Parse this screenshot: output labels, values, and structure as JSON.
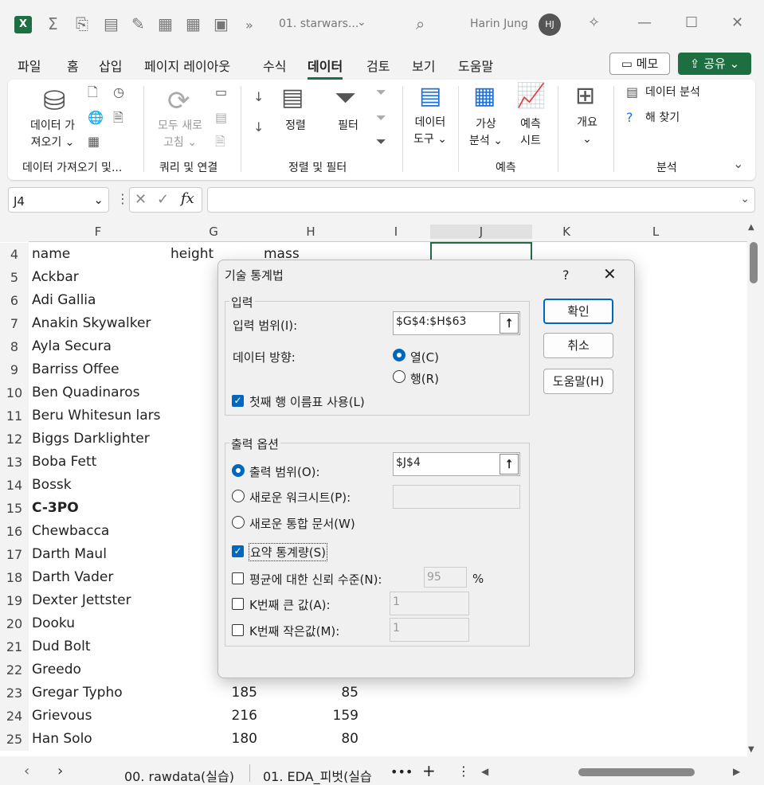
{
  "titlebar": {
    "file_title": "01. starwars...",
    "user_name": "Harin Jung",
    "user_initials": "HJ"
  },
  "ribbon_tabs": [
    "파일",
    "홈",
    "삽입",
    "페이지 레이아웃",
    "수식",
    "데이터",
    "검토",
    "보기",
    "도움말"
  ],
  "active_tab": "데이터",
  "memo_label": "메모",
  "share_label": "공유",
  "ribbon": {
    "get_data_1": "데이터 가",
    "get_data_2": "져오기",
    "refresh_1": "모두 새로",
    "refresh_2": "고침",
    "sort_label": "정렬",
    "filter_label": "필터",
    "data_tools_1": "데이터",
    "data_tools_2": "도구",
    "whatif_1": "가상",
    "whatif_2": "분석",
    "forecast_1": "예측",
    "forecast_2": "시트",
    "outline": "개요",
    "data_analysis": "데이터 분석",
    "solver": "해 찾기",
    "group_get": "데이터 가져오기 및...",
    "group_query": "쿼리 및 연결",
    "group_sort": "정렬 및 필터",
    "group_forecast": "예측",
    "group_analysis": "분석"
  },
  "formula_bar": {
    "name_box": "J4",
    "fx": "fx",
    "formula": ""
  },
  "columns": [
    "F",
    "G",
    "H",
    "I",
    "J",
    "K",
    "L"
  ],
  "rows": [
    {
      "n": "4",
      "name": "name",
      "height": "height",
      "mass": "mass"
    },
    {
      "n": "5",
      "name": "Ackbar",
      "height": "",
      "mass": ""
    },
    {
      "n": "6",
      "name": "Adi Gallia",
      "height": "",
      "mass": ""
    },
    {
      "n": "7",
      "name": "Anakin Skywalker",
      "height": "",
      "mass": ""
    },
    {
      "n": "8",
      "name": "Ayla Secura",
      "height": "",
      "mass": ""
    },
    {
      "n": "9",
      "name": "Barriss Offee",
      "height": "",
      "mass": ""
    },
    {
      "n": "10",
      "name": "Ben Quadinaros",
      "height": "",
      "mass": ""
    },
    {
      "n": "11",
      "name": "Beru Whitesun lars",
      "height": "",
      "mass": ""
    },
    {
      "n": "12",
      "name": "Biggs Darklighter",
      "height": "",
      "mass": ""
    },
    {
      "n": "13",
      "name": "Boba Fett",
      "height": "",
      "mass": ""
    },
    {
      "n": "14",
      "name": "Bossk",
      "height": "",
      "mass": ""
    },
    {
      "n": "15",
      "name": "C-3PO",
      "height": "",
      "mass": ""
    },
    {
      "n": "16",
      "name": "Chewbacca",
      "height": "",
      "mass": ""
    },
    {
      "n": "17",
      "name": "Darth Maul",
      "height": "",
      "mass": ""
    },
    {
      "n": "18",
      "name": "Darth Vader",
      "height": "",
      "mass": ""
    },
    {
      "n": "19",
      "name": "Dexter Jettster",
      "height": "",
      "mass": ""
    },
    {
      "n": "20",
      "name": "Dooku",
      "height": "",
      "mass": ""
    },
    {
      "n": "21",
      "name": "Dud Bolt",
      "height": "",
      "mass": ""
    },
    {
      "n": "22",
      "name": "Greedo",
      "height": "",
      "mass": ""
    },
    {
      "n": "23",
      "name": "Gregar Typho",
      "height": "185",
      "mass": "85"
    },
    {
      "n": "24",
      "name": "Grievous",
      "height": "216",
      "mass": "159"
    },
    {
      "n": "25",
      "name": "Han Solo",
      "height": "180",
      "mass": "80"
    }
  ],
  "sheet_tabs": [
    "00. rawdata(실습)",
    "01. EDA_피벗(실습"
  ],
  "dialog": {
    "title": "기술 통계법",
    "help": "?",
    "input_legend": "입력",
    "input_range_label": "입력 범위(I):",
    "input_range_value": "$G$4:$H$63",
    "direction_label": "데이터 방향:",
    "col_label": "열(C)",
    "row_label": "행(R)",
    "first_row_label": "첫째 행 이름표 사용(L)",
    "output_legend": "출력 옵션",
    "output_range_label": "출력 범위(O):",
    "output_range_value": "$J$4",
    "new_sheet_label": "새로운 워크시트(P):",
    "new_book_label": "새로운 통합 문서(W)",
    "summary_label": "요약 통계량(S)",
    "confidence_label": "평균에 대한 신뢰 수준(N):",
    "confidence_value": "95",
    "percent": "%",
    "kth_large_label": "K번째 큰 값(A):",
    "kth_large_value": "1",
    "kth_small_label": "K번째 작은값(M):",
    "kth_small_value": "1",
    "ok": "확인",
    "cancel": "취소",
    "help_btn": "도움말(H)"
  }
}
